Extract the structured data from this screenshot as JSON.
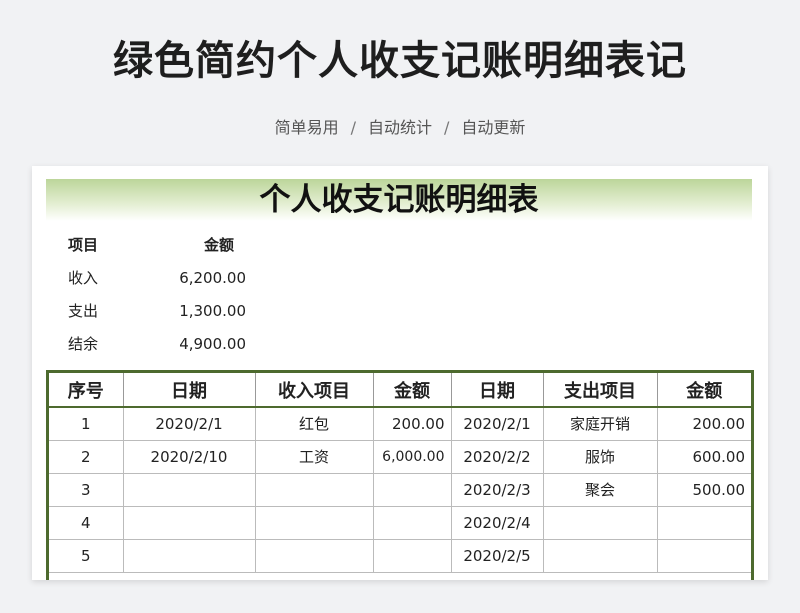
{
  "page": {
    "title": "绿色简约个人收支记账明细表记",
    "subtitle": [
      "简单易用",
      "自动统计",
      "自动更新"
    ],
    "separator": "/"
  },
  "sheet": {
    "title": "个人收支记账明细表",
    "summary": {
      "headers": [
        "项目",
        "金额"
      ],
      "rows": [
        {
          "item": "收入",
          "amount": "6,200.00"
        },
        {
          "item": "支出",
          "amount": "1,300.00"
        },
        {
          "item": "结余",
          "amount": "4,900.00"
        }
      ]
    },
    "ledger": {
      "headers": [
        "序号",
        "日期",
        "收入项目",
        "金额",
        "日期",
        "支出项目",
        "金额"
      ],
      "rows": [
        {
          "no": "1",
          "in_date": "2020/2/1",
          "in_item": "红包",
          "in_amount": "200.00",
          "out_date": "2020/2/1",
          "out_item": "家庭开销",
          "out_amount": "200.00"
        },
        {
          "no": "2",
          "in_date": "2020/2/10",
          "in_item": "工资",
          "in_amount": "6,000.00",
          "out_date": "2020/2/2",
          "out_item": "服饰",
          "out_amount": "600.00"
        },
        {
          "no": "3",
          "in_date": "",
          "in_item": "",
          "in_amount": "",
          "out_date": "2020/2/3",
          "out_item": "聚会",
          "out_amount": "500.00"
        },
        {
          "no": "4",
          "in_date": "",
          "in_item": "",
          "in_amount": "",
          "out_date": "2020/2/4",
          "out_item": "",
          "out_amount": ""
        },
        {
          "no": "5",
          "in_date": "",
          "in_item": "",
          "in_amount": "",
          "out_date": "2020/2/5",
          "out_item": "",
          "out_amount": ""
        }
      ]
    },
    "colors": {
      "accent_green": "#4d6a2e",
      "header_gradient_top": "#bcd59a"
    }
  }
}
